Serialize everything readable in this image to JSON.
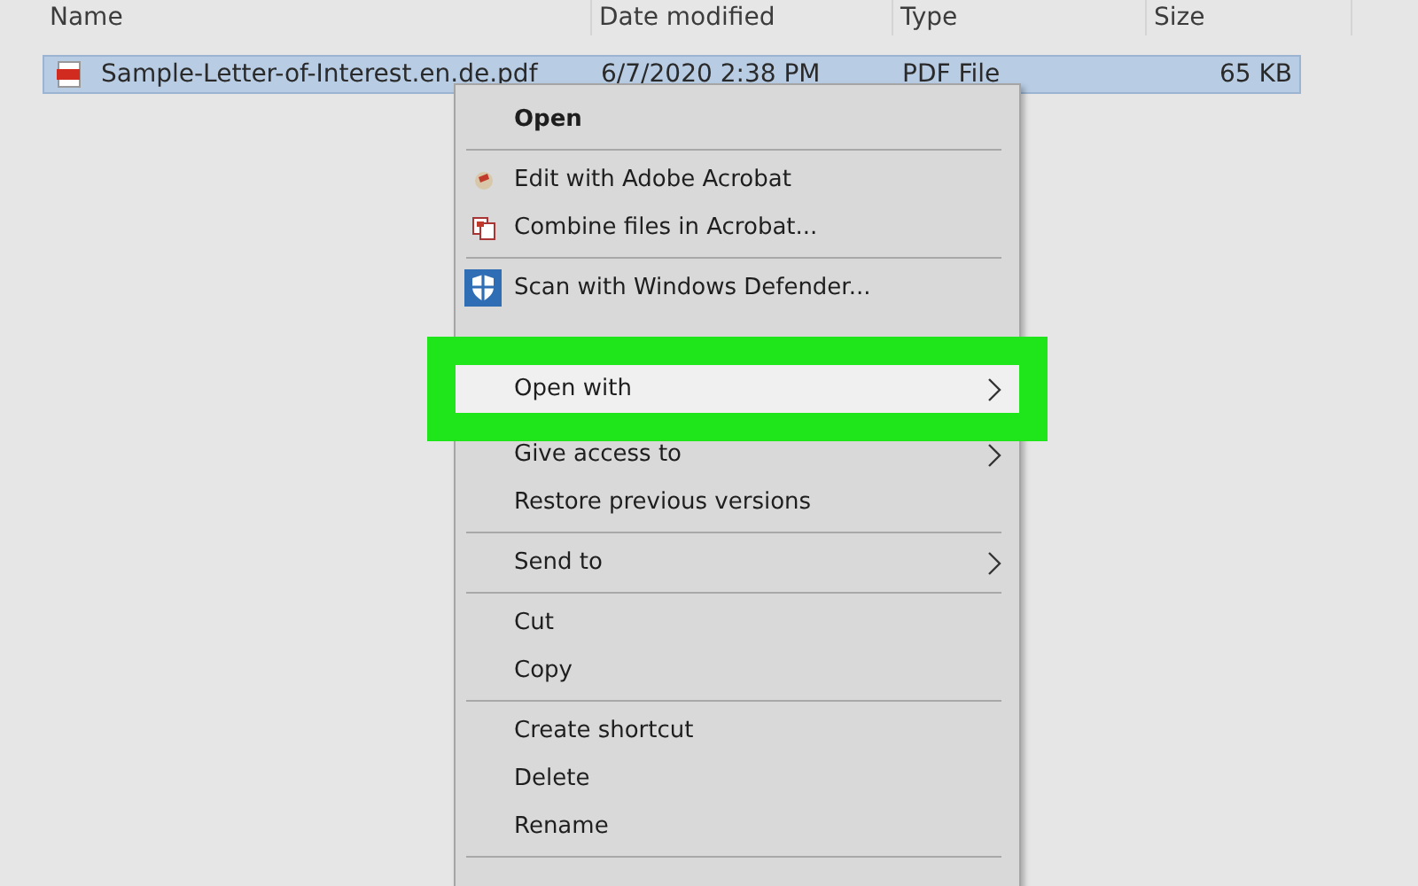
{
  "columns": [
    {
      "label": "Name"
    },
    {
      "label": "Date modified"
    },
    {
      "label": "Type"
    },
    {
      "label": "Size"
    }
  ],
  "files": [
    {
      "name": "Sample-Letter-of-Interest.en.de.pdf",
      "date": "6/7/2020 2:38 PM",
      "type": "PDF File",
      "size": "65 KB",
      "selected": true
    }
  ],
  "context_menu": {
    "items": [
      {
        "kind": "item",
        "label": "Open",
        "default": true,
        "selected": false
      },
      {
        "kind": "separator"
      },
      {
        "kind": "acrobat",
        "label": "Edit with Adobe Acrobat",
        "selected": false
      },
      {
        "kind": "combine",
        "label": "Combine files in Acrobat...",
        "selected": false
      },
      {
        "kind": "separator"
      },
      {
        "kind": "shield",
        "label": "Scan with Windows Defender...",
        "selected": false
      },
      {
        "kind": "hidden"
      },
      {
        "kind": "item",
        "label": "Open with",
        "submenu": true,
        "selected": true,
        "highlighted": true
      },
      {
        "kind": "item",
        "label": "Give access to",
        "submenu": true,
        "selected": false
      },
      {
        "kind": "item",
        "label": "Restore previous versions",
        "selected": false
      },
      {
        "kind": "separator"
      },
      {
        "kind": "item",
        "label": "Send to",
        "submenu": true,
        "selected": false
      },
      {
        "kind": "separator"
      },
      {
        "kind": "item",
        "label": "Cut",
        "selected": false
      },
      {
        "kind": "item",
        "label": "Copy",
        "selected": false
      },
      {
        "kind": "separator"
      },
      {
        "kind": "item",
        "label": "Create shortcut",
        "selected": false
      },
      {
        "kind": "item",
        "label": "Delete",
        "selected": false
      },
      {
        "kind": "item",
        "label": "Rename",
        "selected": false
      },
      {
        "kind": "separator"
      },
      {
        "kind": "hidden"
      }
    ]
  }
}
